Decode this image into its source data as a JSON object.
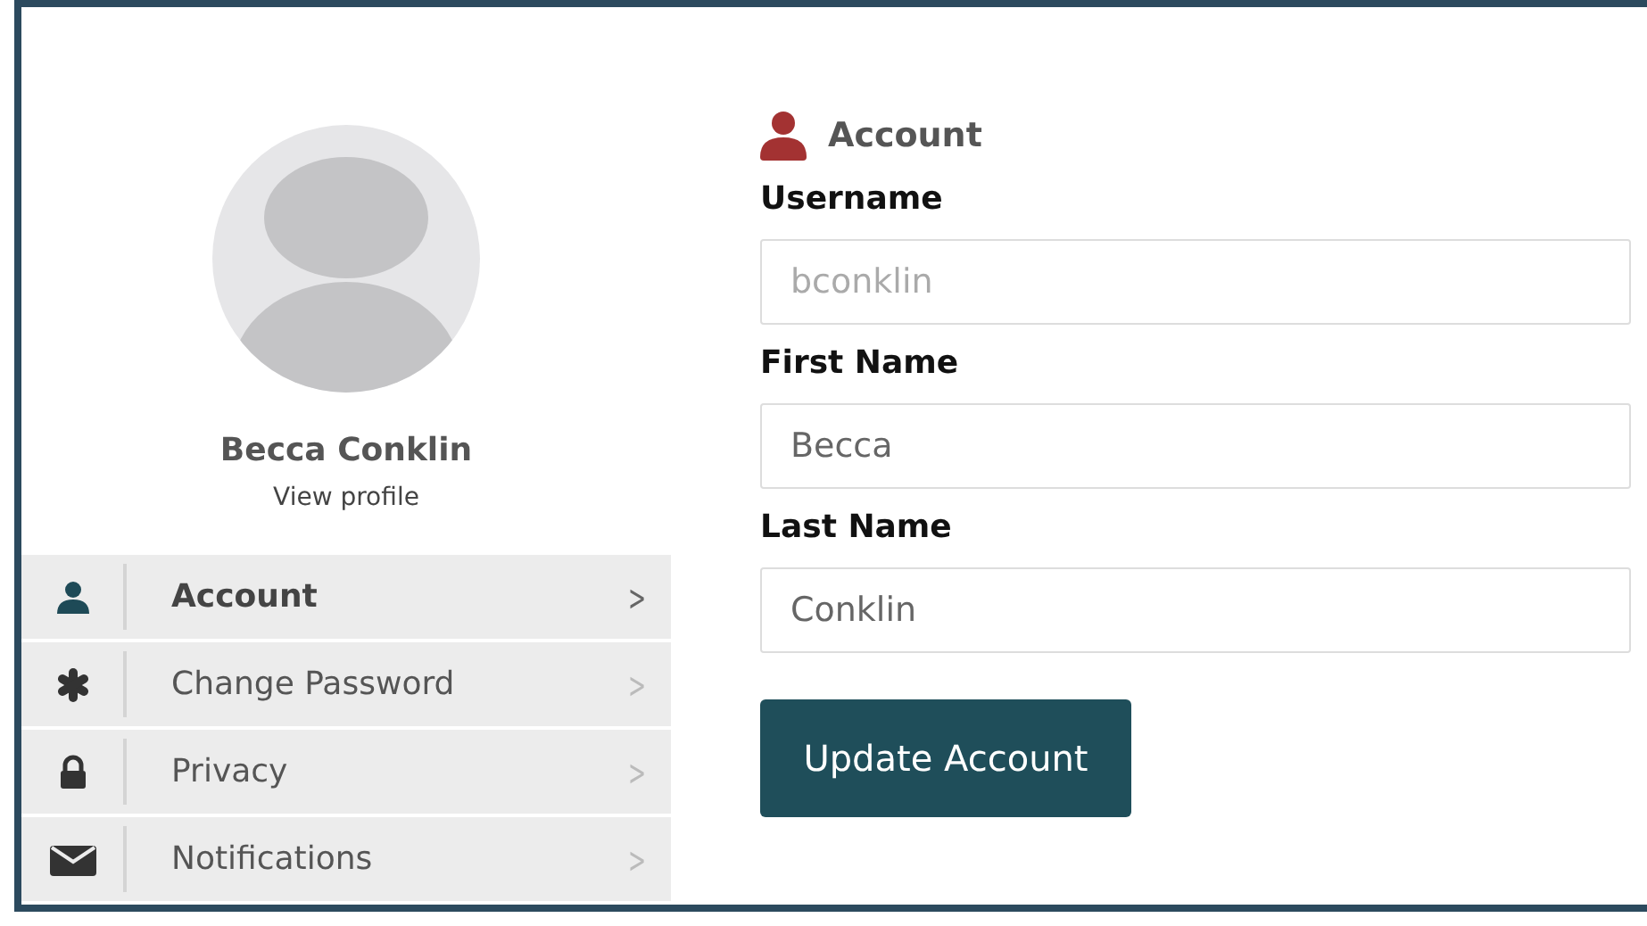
{
  "profile": {
    "name": "Becca Conklin",
    "link": "View profile"
  },
  "menu": [
    {
      "kind": "person",
      "label": "Account",
      "selected": true,
      "chevron": ">"
    },
    {
      "kind": "asterisk",
      "label": "Change Password",
      "selected": false,
      "chevron": ">"
    },
    {
      "kind": "lock",
      "label": "Privacy",
      "selected": false,
      "chevron": ">"
    },
    {
      "kind": "envelope",
      "label": "Notifications",
      "selected": false,
      "chevron": ">"
    }
  ],
  "section": {
    "title": "Account"
  },
  "fields": [
    {
      "label": "Username",
      "value": "bconklin",
      "disabled": true
    },
    {
      "label": "First Name",
      "value": "Becca",
      "disabled": false
    },
    {
      "label": "Last Name",
      "value": "Conklin",
      "disabled": false
    }
  ],
  "submit": "Update Account"
}
